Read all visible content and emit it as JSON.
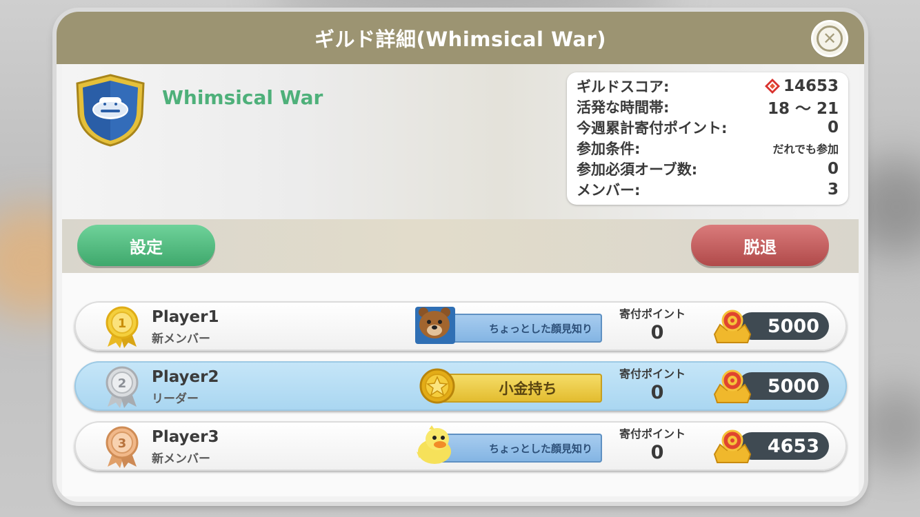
{
  "dialog": {
    "title": "ギルド詳細(Whimsical War)",
    "close_icon": "close-icon"
  },
  "guild": {
    "name": "Whimsical War",
    "emblem_icon": "shield-emblem-icon"
  },
  "info": {
    "score_label": "ギルドスコア:",
    "score_value": "14653",
    "active_label": "活発な時間帯:",
    "active_value": "18 ～ 21",
    "weekly_label": "今週累計寄付ポイント:",
    "weekly_value": "0",
    "join_label": "参加条件:",
    "join_value": "だれでも参加",
    "orb_label": "参加必須オーブ数:",
    "orb_value": "0",
    "members_label": "メンバー:",
    "members_value": "3"
  },
  "buttons": {
    "settings": "設定",
    "leave": "脱退"
  },
  "members": [
    {
      "name": "Player1",
      "role": "新メンバー",
      "rank": "1",
      "title": "ちょっとした顔見知り",
      "donation_label": "寄付ポイント",
      "donation": "0",
      "crown_points": "5000"
    },
    {
      "name": "Player2",
      "role": "リーダー",
      "rank": "2",
      "title": "小金持ち",
      "donation_label": "寄付ポイント",
      "donation": "0",
      "crown_points": "5000"
    },
    {
      "name": "Player3",
      "role": "新メンバー",
      "rank": "3",
      "title": "ちょっとした顔見知り",
      "donation_label": "寄付ポイント",
      "donation": "0",
      "crown_points": "4653"
    }
  ],
  "colors": {
    "title_bar": "#9c9472",
    "guild_name": "#4eb07a",
    "settings_button": "#4fba7c",
    "leave_button": "#c45e5e",
    "leader_row": "#b8def5"
  }
}
